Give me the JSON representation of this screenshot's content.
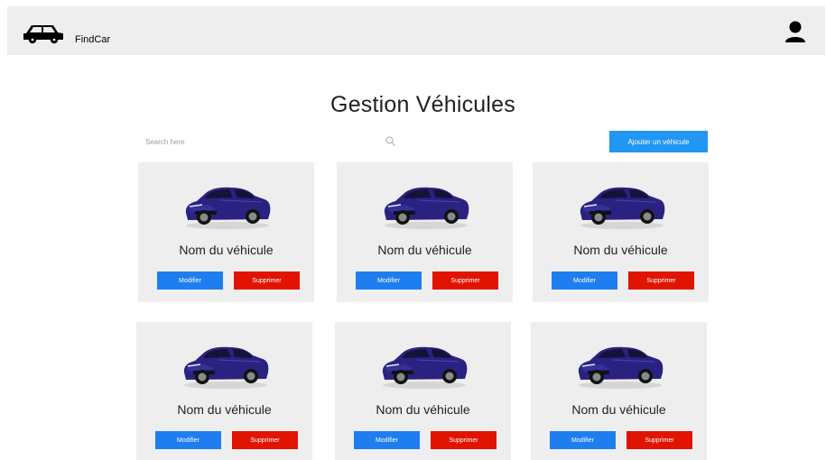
{
  "header": {
    "brand": "FindCar"
  },
  "page": {
    "title": "Gestion Véhicules"
  },
  "search": {
    "placeholder": "Search here"
  },
  "toolbar": {
    "add_label": "Ajouter un véhicule"
  },
  "colors": {
    "primary": "#2196f3",
    "edit": "#1e7ef0",
    "delete": "#e01400",
    "card_bg": "#eeeeee",
    "car_body": "#2a2280"
  },
  "vehicles": [
    {
      "name": "Nom du véhicule",
      "edit_label": "Modifier",
      "delete_label": "Supprimer"
    },
    {
      "name": "Nom du véhicule",
      "edit_label": "Modifier",
      "delete_label": "Supprimer"
    },
    {
      "name": "Nom du véhicule",
      "edit_label": "Modifier",
      "delete_label": "Supprimer"
    },
    {
      "name": "Nom du véhicule",
      "edit_label": "Modifier",
      "delete_label": "Supprimer"
    },
    {
      "name": "Nom du véhicule",
      "edit_label": "Modifier",
      "delete_label": "Supprimer"
    },
    {
      "name": "Nom du véhicule",
      "edit_label": "Modifier",
      "delete_label": "Supprimer"
    }
  ]
}
